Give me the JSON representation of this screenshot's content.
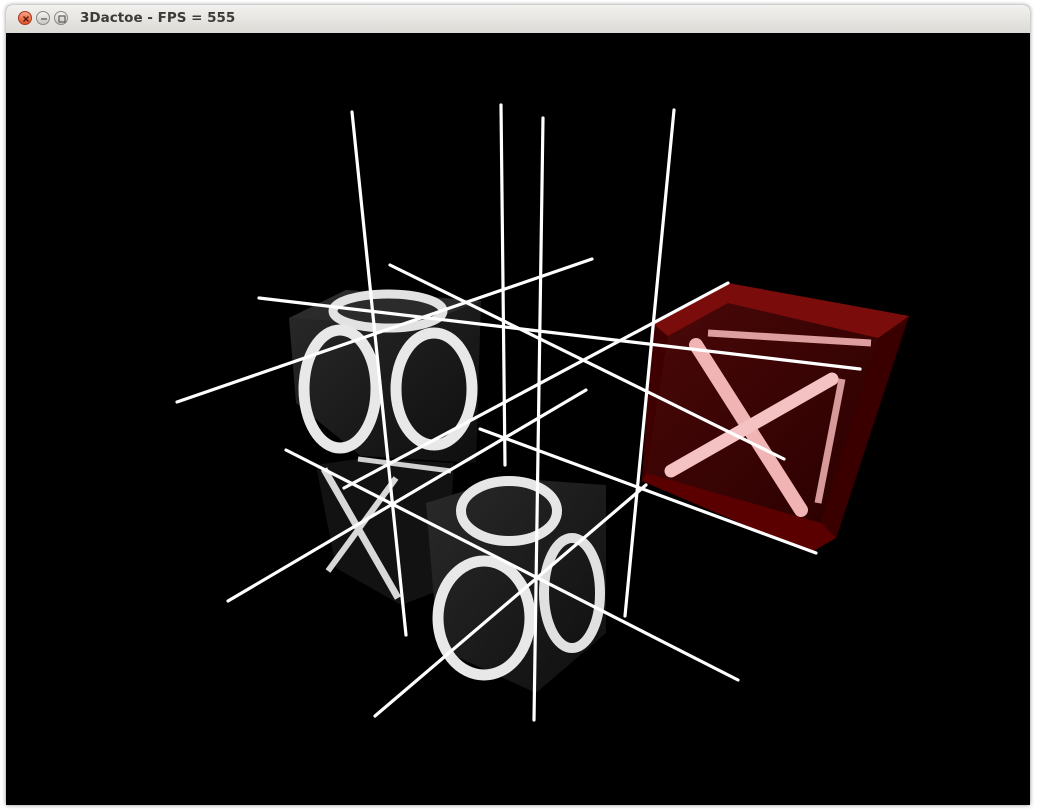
{
  "window": {
    "title": "3Dactoe - FPS = 555"
  },
  "game": {
    "board_size": "3x3x3",
    "pieces": [
      {
        "mark": "O",
        "cell": "top-left-back"
      },
      {
        "mark": "O",
        "cell": "center-front"
      },
      {
        "mark": "X",
        "cell": "bottom-left"
      },
      {
        "mark": "X",
        "cell": "right-highlighted"
      }
    ],
    "highlight_color": "#6a0000",
    "grid_color": "#ffffff",
    "background_color": "#000000"
  }
}
